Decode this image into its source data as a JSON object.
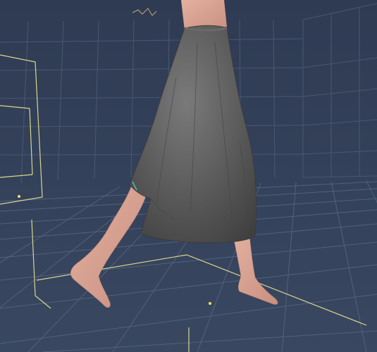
{
  "scene": {
    "background_color": "#34425c",
    "grid_color": "#4f5f7a",
    "bounding_box_color": "#d8d78a",
    "skin_color": "#d89f8e",
    "cloth_color": "#5b5b5b"
  },
  "icons": {
    "viewport": "3d-viewport",
    "figure": "human-figure",
    "garment": "cloth-skirt",
    "floor": "ground-grid"
  }
}
